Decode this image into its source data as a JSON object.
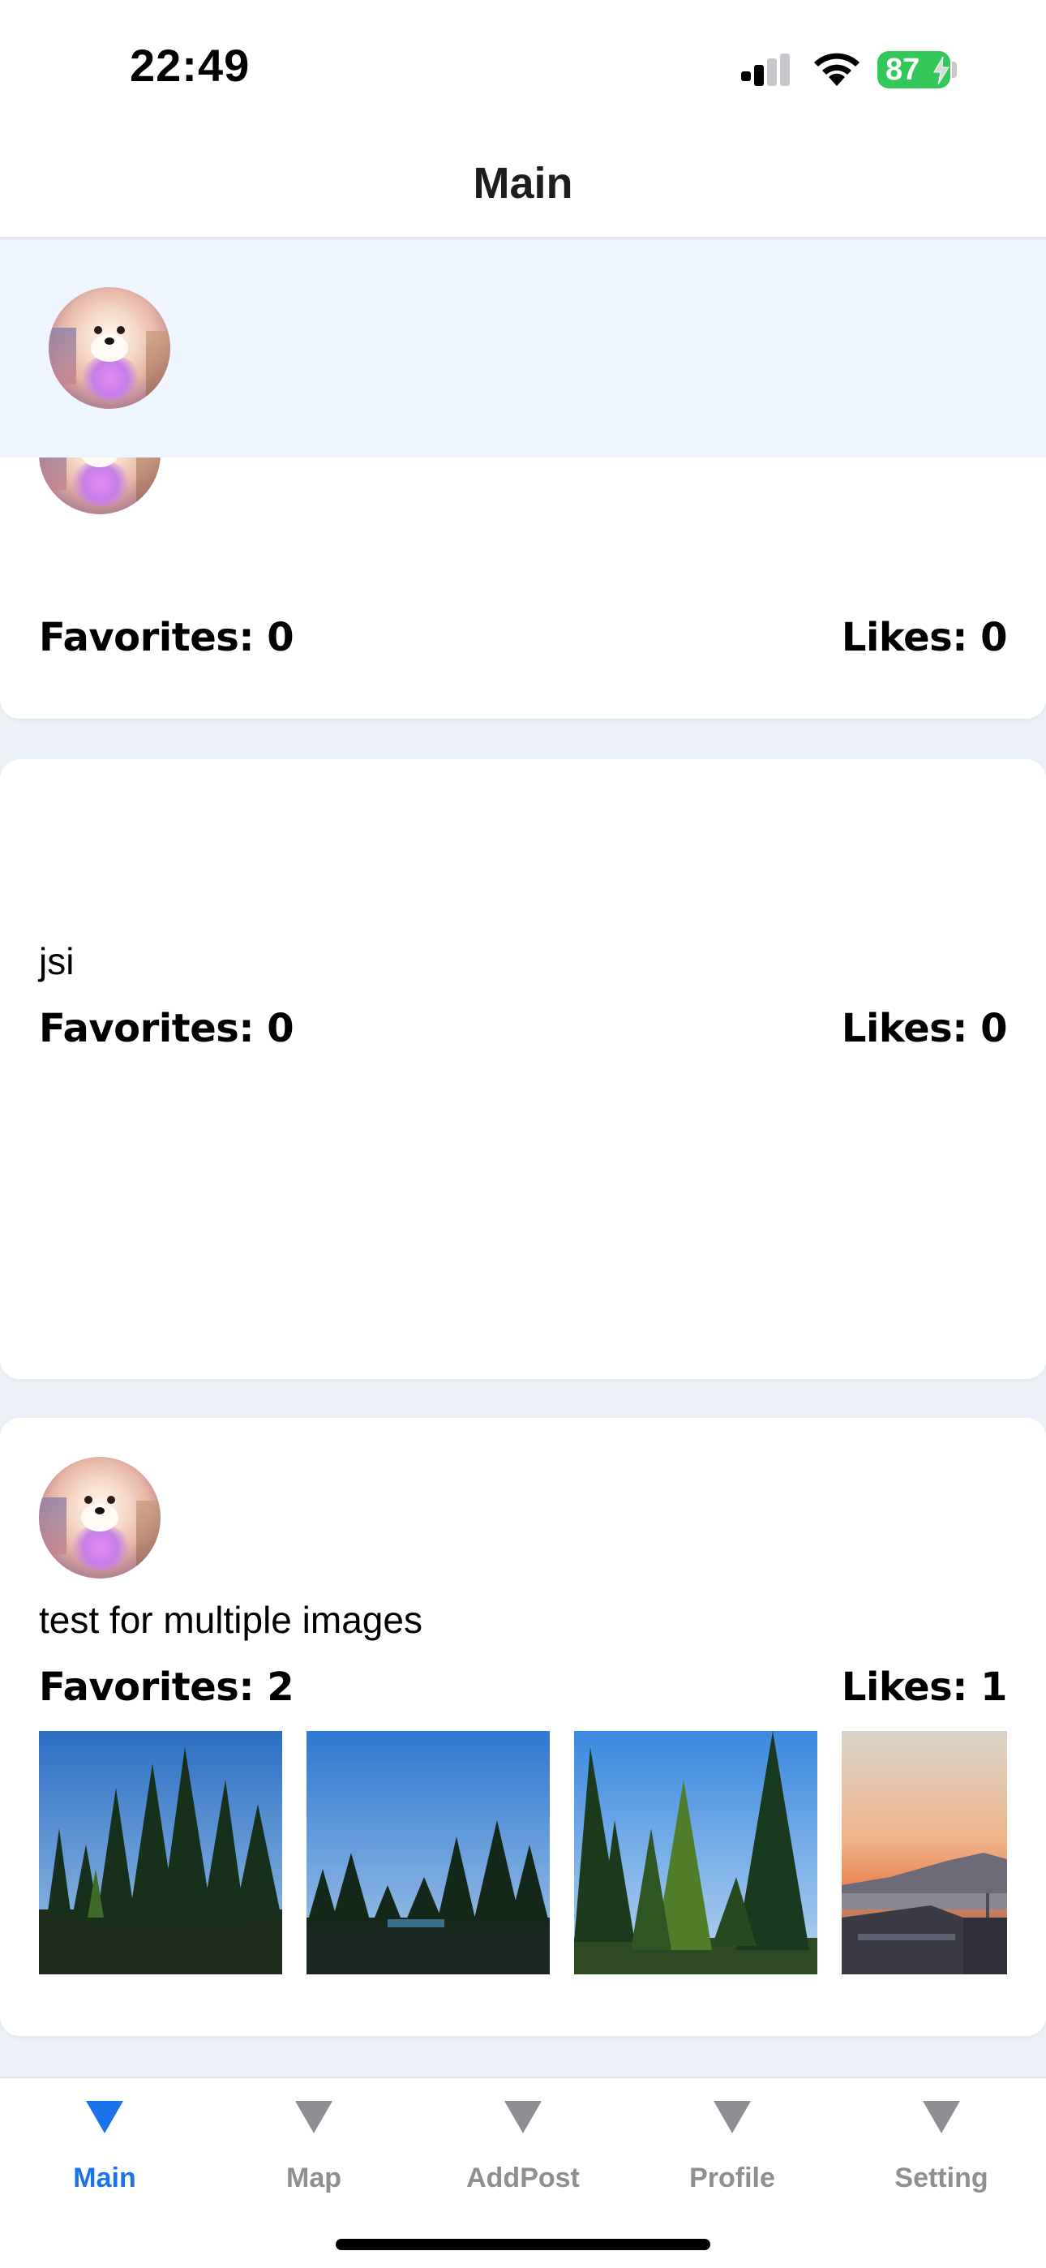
{
  "status_bar": {
    "time": "22:49",
    "battery": "87"
  },
  "header": {
    "title": "Main"
  },
  "posts": [
    {
      "text": "",
      "favorites": "Favorites: 0",
      "likes": "Likes: 0"
    },
    {
      "text": "jsi",
      "favorites": "Favorites: 0",
      "likes": "Likes: 0"
    },
    {
      "text": "test for multiple images",
      "favorites": "Favorites: 2",
      "likes": "Likes: 1"
    }
  ],
  "tabs": [
    {
      "label": "Main",
      "active": true
    },
    {
      "label": "Map",
      "active": false
    },
    {
      "label": "AddPost",
      "active": false
    },
    {
      "label": "Profile",
      "active": false
    },
    {
      "label": "Setting",
      "active": false
    }
  ],
  "colors": {
    "accent": "#1a73e8",
    "inactive": "#8e8e93",
    "battery": "#34c759"
  }
}
